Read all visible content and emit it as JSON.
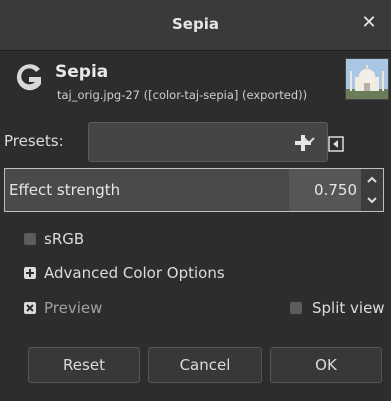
{
  "window": {
    "title": "Sepia",
    "close_glyph": "✕"
  },
  "header": {
    "title": "Sepia",
    "subtitle": "taj_orig.jpg-27 ([color-taj-sepia] (exported))",
    "icon": "gimp-logo-icon",
    "thumbnail": "taj-mahal-thumbnail"
  },
  "presets": {
    "label": "Presets:",
    "value": "",
    "add_icon": "plus-icon",
    "menu_icon": "menu-arrow-icon"
  },
  "effect": {
    "label": "Effect strength",
    "value": "0.750",
    "fraction": 0.75
  },
  "options": {
    "srgb": {
      "label": "sRGB",
      "checked": false
    },
    "advanced": {
      "label": "Advanced Color Options",
      "expanded": false
    },
    "preview": {
      "label": "Preview",
      "checked": true
    },
    "split_view": {
      "label": "Split view",
      "checked": false
    }
  },
  "buttons": {
    "reset": "Reset",
    "cancel": "Cancel",
    "ok": "OK"
  },
  "colors": {
    "background": "#2d2d2d",
    "titlebar": "#3a3a3a",
    "slider_fill": "#4a4a4a",
    "slider_bg": "#565656"
  }
}
